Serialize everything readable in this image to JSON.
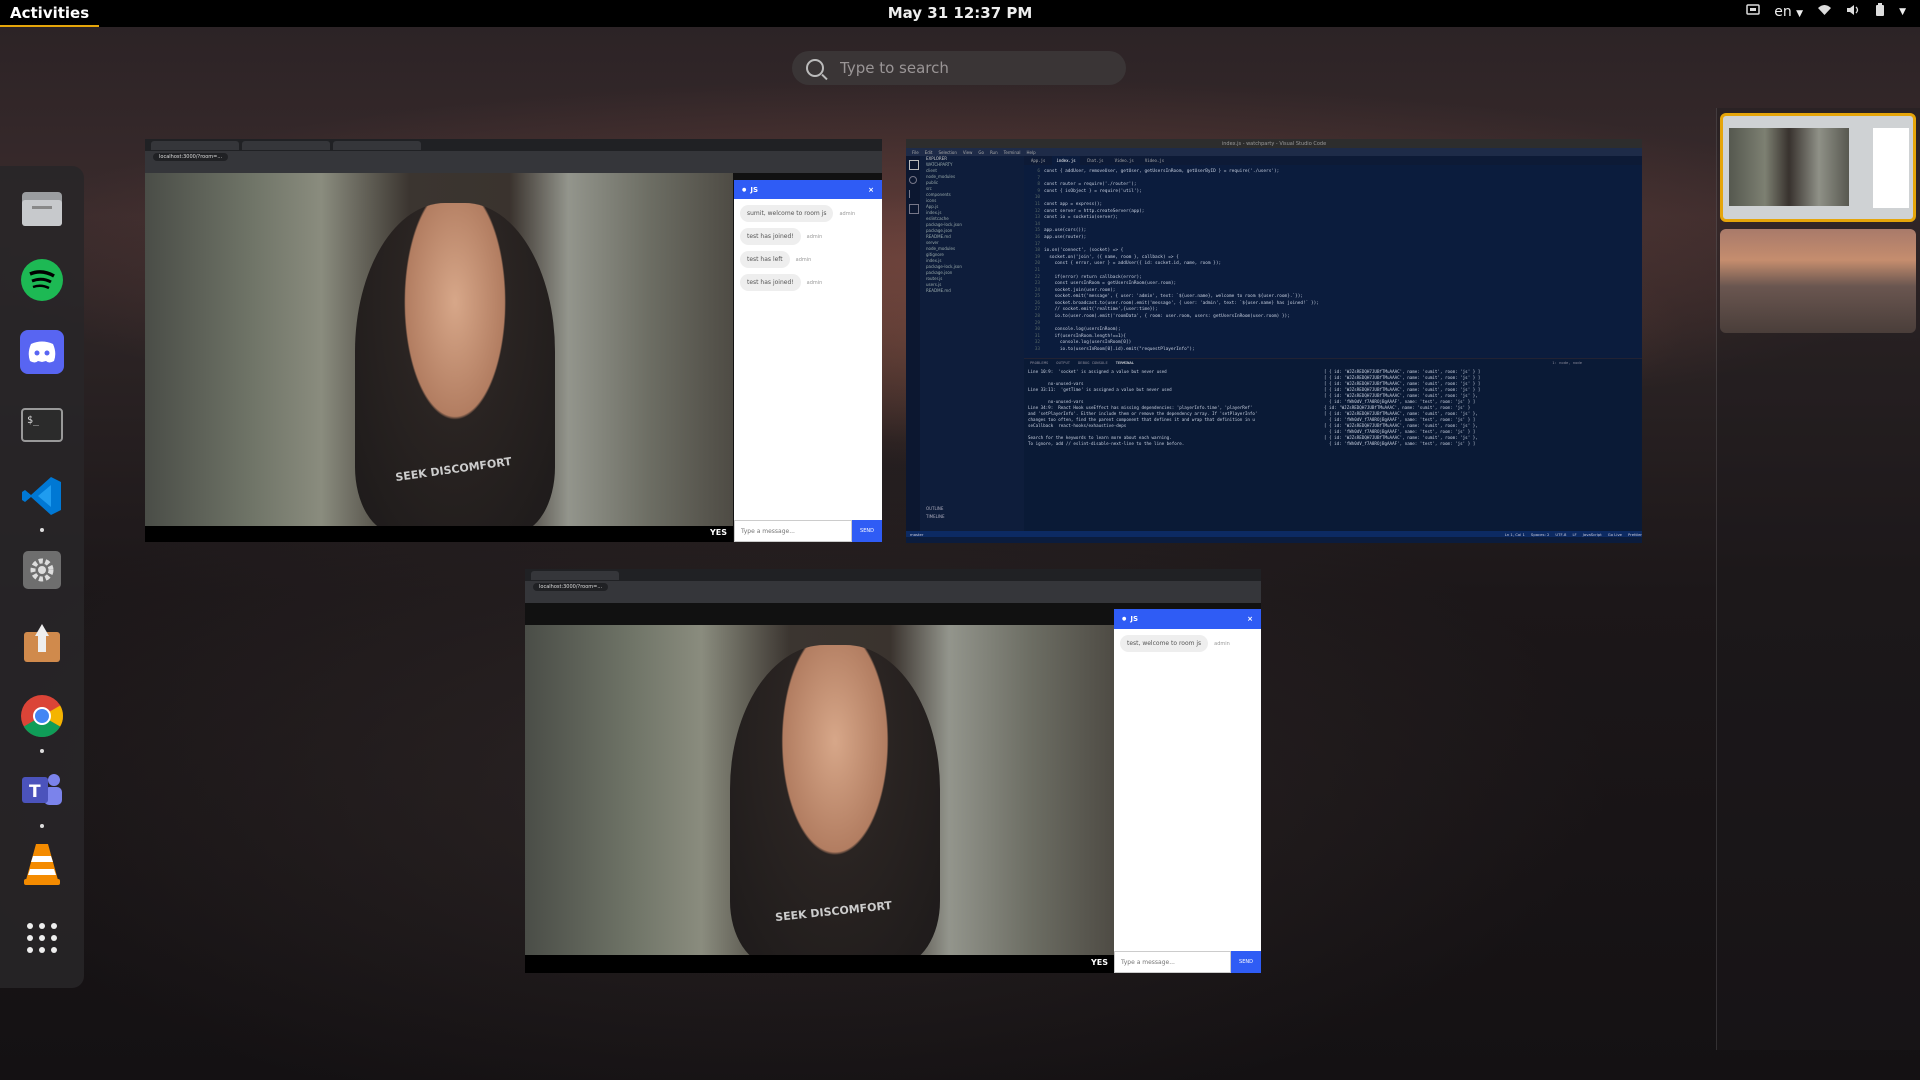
{
  "topbar": {
    "activities": "Activities",
    "clock": "May 31  12:37 PM",
    "language": "en",
    "icons": [
      "screen-share-icon",
      "wifi-icon",
      "volume-icon",
      "battery-icon",
      "chevron-down-icon"
    ]
  },
  "search": {
    "placeholder": "Type to search"
  },
  "dock": {
    "apps": [
      "files",
      "spotify",
      "discord",
      "terminal",
      "vscode",
      "settings",
      "app-installer",
      "chrome",
      "teams",
      "vlc",
      "show-apps"
    ]
  },
  "browser1": {
    "tabs": [
      "",
      "",
      ""
    ],
    "url": "localhost:3000/?room=...",
    "chat": {
      "room": "JS",
      "messages": [
        {
          "text": "sumit, welcome to room js",
          "from": "admin"
        },
        {
          "text": "test has joined!",
          "from": "admin"
        },
        {
          "text": "test has left",
          "from": "admin"
        },
        {
          "text": "test has joined!",
          "from": "admin"
        }
      ],
      "input_placeholder": "Type a message...",
      "send": "SEND"
    },
    "watermark": "YES",
    "hoodie": "SEEK DISCOMFORT"
  },
  "browser2": {
    "tabs": [
      ""
    ],
    "url": "localhost:3000/?room=...",
    "chat": {
      "room": "JS",
      "messages": [
        {
          "text": "test, welcome to room js",
          "from": "admin"
        }
      ],
      "input_placeholder": "Type a message...",
      "send": "SEND"
    },
    "watermark": "YES",
    "hoodie": "SEEK DISCOMFORT"
  },
  "vscode": {
    "title": "index.js - watchparty - Visual Studio Code",
    "menu": [
      "File",
      "Edit",
      "Selection",
      "View",
      "Go",
      "Run",
      "Terminal",
      "Help"
    ],
    "tabs": [
      "App.js",
      "index.js",
      "Chat.js",
      "Video.js",
      "Video.js"
    ],
    "explorer_header": "EXPLORER",
    "explorer": [
      "WATCHPARTY",
      "client",
      "node_modules",
      "public",
      "src",
      "components",
      "icons",
      "App.js",
      "index.js",
      "eslintcache",
      "package-lock.json",
      "package.json",
      "README.md",
      "server",
      "node_modules",
      "gitignore",
      "index.js",
      "package-lock.json",
      "package.json",
      "router.js",
      "users.js",
      "README.md"
    ],
    "code": [
      "const { addUser, removeUser, getUser, getUsersInRoom, getUserByID } = require('./users');",
      "",
      "const router = require('./router');",
      "const { isObject } = require('util');",
      "",
      "const app = express();",
      "const server = http.createServer(app);",
      "const io = socketio(server);",
      "",
      "app.use(cors());",
      "app.use(router);",
      "",
      "io.on('connect', (socket) => {",
      "  socket.on('join', ({ name, room }, callback) => {",
      "    const { error, user } = addUser({ id: socket.id, name, room });",
      "",
      "    if(error) return callback(error);",
      "    const usersInRoom = getUsersInRoom(user.room);",
      "    socket.join(user.room);",
      "    socket.emit('message', { user: 'admin', text: `${user.name}, welcome to room ${user.room}.`});",
      "    socket.broadcast.to(user.room).emit('message', { user: 'admin', text: `${user.name} has joined!` });",
      "    // socket.emit('realtime',{user:time});",
      "    io.to(user.room).emit('roomData', { room: user.room, users: getUsersInRoom(user.room) });",
      "",
      "    console.log(usersInRoom);",
      "    if(usersInRoom.length!==1){",
      "      console.log(usersInRoom[0])",
      "      io.to(usersInRoom[0].id).emit(\"requestPlayerInfo\");"
    ],
    "panel_tabs": [
      "PROBLEMS",
      "OUTPUT",
      "DEBUG CONSOLE",
      "TERMINAL"
    ],
    "terminal_left": [
      "Line 10:9:  'socket' is assigned a value but never used",
      "",
      "        no-unused-vars",
      "Line 33:11:  'getTime' is assigned a value but never used",
      "",
      "        no-unused-vars",
      "Line 34:9:  React Hook useEffect has missing dependencies: 'playerInfo.time', 'playerRef'",
      "and 'setPlayerInfo'. Either include them or remove the dependency array. If 'setPlayerInfo'",
      "changes too often, find the parent component that defines it and wrap that definition in u",
      "seCallback  react-hooks/exhaustive-deps",
      "",
      "Search for the keywords to learn more about each warning.",
      "To ignore, add // eslint-disable-next-line to the line before."
    ],
    "terminal_right": [
      "[ { id: 'WJZsREDQH7JUBfTMuAAAC', name: 'sumit', room: 'js' } ]",
      "[ { id: 'WJZsREDQH7JUBfTMuAAAC', name: 'sumit', room: 'js' } ]",
      "[ { id: 'WJZsREDQH7JUBfTMuAAAC', name: 'sumit', room: 'js' } ]",
      "[ { id: 'WJZsREDQH7JUBfTMuAAAC', name: 'sumit', room: 'js' } ]",
      "[ { id: 'WJZsREDQH7JUBfTMuAAAC', name: 'sumit', room: 'js' },",
      "  { id: 'fWh0dV_f7A8ROjBgAAAF', name: 'test', room: 'js' } ]",
      "{ id: 'WJZsREDQH7JUBfTMuAAAC', name: 'sumit', room: 'js' }",
      "[ { id: 'WJZsREDQH7JUBfTMuAAAC', name: 'sumit', room: 'js' },",
      "  { id: 'fWh0dV_f7A8ROjBgAAAF', name: 'test', room: 'js' } ]",
      "[ { id: 'WJZsREDQH7JUBfTMuAAAC', name: 'sumit', room: 'js' },",
      "  { id: 'fWh0dV_f7A8ROjBgAAAF', name: 'test', room: 'js' } ]",
      "[ { id: 'WJZsREDQH7JUBfTMuAAAC', name: 'sumit', room: 'js' },",
      "  { id: 'fWh0dV_f7A8ROjBgAAAF', name: 'test', room: 'js' } ]"
    ],
    "terminal_selector": "1: node, node",
    "status": [
      "master",
      "Ln 1, Col 1",
      "Spaces: 2",
      "UTF-8",
      "LF",
      "JavaScript",
      "Go Live",
      "Prettier"
    ],
    "outline": [
      "OUTLINE",
      "TIMELINE"
    ]
  },
  "colors": {
    "accent": "#2f5cf5",
    "activities_underline": "#e5a50a"
  }
}
